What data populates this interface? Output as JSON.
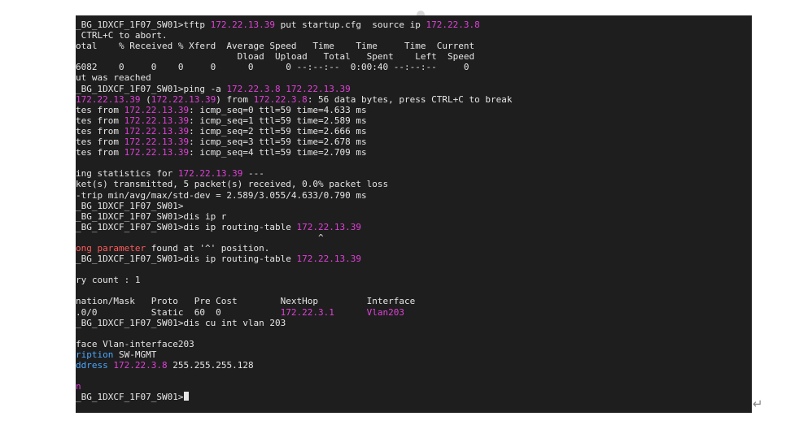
{
  "colors": {
    "background": "#1e1e1e",
    "text": "#e6e6e6",
    "ip": "#e040d8",
    "error": "#ff5a5a",
    "keyword": "#4aa8ff"
  },
  "icons": {
    "top_marker": "circle-marker-icon",
    "return_mark": "paragraph-return-icon",
    "return_glyph": "↵"
  },
  "terminal": {
    "lines": [
      [
        {
          "t": "_BG_1DXCF_1F07_SW01>tftp "
        },
        {
          "t": "172.22.13.39",
          "c": "ip"
        },
        {
          "t": " put startup.cfg  source ip "
        },
        {
          "t": "172.22.3.8",
          "c": "ip"
        }
      ],
      [
        {
          "t": " CTRL+C to abort."
        }
      ],
      [
        {
          "t": "otal    % Received % Xferd  Average Speed   Time    Time     Time  Current"
        }
      ],
      [
        {
          "t": "                              Dload  Upload   Total   Spent    Left  Speed"
        }
      ],
      [
        {
          "t": "6082    0     0    0     0      0      0 --:--:--  0:00:40 --:--:--     0"
        }
      ],
      [
        {
          "t": "ut was reached"
        }
      ],
      [
        {
          "t": "_BG_1DXCF_1F07_SW01>ping -a "
        },
        {
          "t": "172.22.3.8",
          "c": "ip"
        },
        {
          "t": " "
        },
        {
          "t": "172.22.13.39",
          "c": "ip"
        }
      ],
      [
        {
          "t": "172.22.13.39",
          "c": "ip"
        },
        {
          "t": " ("
        },
        {
          "t": "172.22.13.39",
          "c": "ip"
        },
        {
          "t": ") from "
        },
        {
          "t": "172.22.3.8",
          "c": "ip"
        },
        {
          "t": ": 56 data bytes, press CTRL+C to break"
        }
      ],
      [
        {
          "t": "tes from "
        },
        {
          "t": "172.22.13.39",
          "c": "ip"
        },
        {
          "t": ": icmp_seq=0 ttl=59 time=4.633 ms"
        }
      ],
      [
        {
          "t": "tes from "
        },
        {
          "t": "172.22.13.39",
          "c": "ip"
        },
        {
          "t": ": icmp_seq=1 ttl=59 time=2.589 ms"
        }
      ],
      [
        {
          "t": "tes from "
        },
        {
          "t": "172.22.13.39",
          "c": "ip"
        },
        {
          "t": ": icmp_seq=2 ttl=59 time=2.666 ms"
        }
      ],
      [
        {
          "t": "tes from "
        },
        {
          "t": "172.22.13.39",
          "c": "ip"
        },
        {
          "t": ": icmp_seq=3 ttl=59 time=2.678 ms"
        }
      ],
      [
        {
          "t": "tes from "
        },
        {
          "t": "172.22.13.39",
          "c": "ip"
        },
        {
          "t": ": icmp_seq=4 ttl=59 time=2.709 ms"
        }
      ],
      [],
      [
        {
          "t": "ing statistics for "
        },
        {
          "t": "172.22.13.39",
          "c": "ip"
        },
        {
          "t": " ---"
        }
      ],
      [
        {
          "t": "ket(s) transmitted, 5 packet(s) received, 0.0% packet loss"
        }
      ],
      [
        {
          "t": "-trip min/avg/max/std-dev = 2.589/3.055/4.633/0.790 ms"
        }
      ],
      [
        {
          "t": "_BG_1DXCF_1F07_SW01>"
        }
      ],
      [
        {
          "t": "_BG_1DXCF_1F07_SW01>dis ip r"
        }
      ],
      [
        {
          "t": "_BG_1DXCF_1F07_SW01>dis ip routing-table "
        },
        {
          "t": "172.22.13.39",
          "c": "ip"
        }
      ],
      [
        {
          "t": "                                             ^"
        }
      ],
      [
        {
          "t": "ong parameter",
          "c": "err"
        },
        {
          "t": " found at '^' position."
        }
      ],
      [
        {
          "t": "_BG_1DXCF_1F07_SW01>dis ip routing-table "
        },
        {
          "t": "172.22.13.39",
          "c": "ip"
        }
      ],
      [],
      [
        {
          "t": "ry count : 1"
        }
      ],
      [],
      [
        {
          "t": "nation/Mask   Proto   Pre Cost        NextHop         Interface"
        }
      ],
      [
        {
          "t": ".0/0          Static  60  0           "
        },
        {
          "t": "172.22.3.1",
          "c": "ip"
        },
        {
          "t": "      "
        },
        {
          "t": "Vlan203",
          "c": "ip"
        }
      ],
      [
        {
          "t": "_BG_1DXCF_1F07_SW01>dis cu int vlan 203"
        }
      ],
      [],
      [
        {
          "t": "face Vlan-interface203"
        }
      ],
      [
        {
          "t": "ription",
          "c": "kw"
        },
        {
          "t": " SW-MGMT"
        }
      ],
      [
        {
          "t": "ddress",
          "c": "kw"
        },
        {
          "t": " "
        },
        {
          "t": "172.22.3.8",
          "c": "ip"
        },
        {
          "t": " 255.255.255.128"
        }
      ],
      [],
      [
        {
          "t": "n",
          "c": "ip"
        }
      ],
      [
        {
          "t": "_BG_1DXCF_1F07_SW01>"
        }
      ]
    ]
  }
}
